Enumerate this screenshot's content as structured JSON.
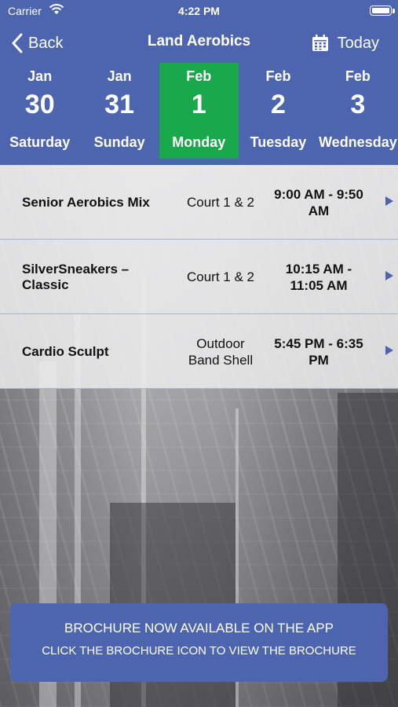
{
  "status_bar": {
    "carrier": "Carrier",
    "time": "4:22 PM"
  },
  "nav": {
    "back_label": "Back",
    "title": "Land Aerobics",
    "today_label": "Today"
  },
  "dates": [
    {
      "month": "Jan",
      "day": "30",
      "weekday": "Saturday",
      "selected": false
    },
    {
      "month": "Jan",
      "day": "31",
      "weekday": "Sunday",
      "selected": false
    },
    {
      "month": "Feb",
      "day": "1",
      "weekday": "Monday",
      "selected": true
    },
    {
      "month": "Feb",
      "day": "2",
      "weekday": "Tuesday",
      "selected": false
    },
    {
      "month": "Feb",
      "day": "3",
      "weekday": "Wednesday",
      "selected": false
    }
  ],
  "sessions": [
    {
      "name": "Senior Aerobics Mix",
      "location": "Court 1 & 2",
      "time": "9:00 AM - 9:50 AM"
    },
    {
      "name": "SilverSneakers – Classic",
      "location": "Court 1 & 2",
      "time": "10:15 AM - 11:05 AM"
    },
    {
      "name": "Cardio Sculpt",
      "location": "Outdoor Band Shell",
      "time": "5:45 PM - 6:35 PM"
    }
  ],
  "brochure": {
    "line1": "BROCHURE NOW AVAILABLE ON THE APP",
    "line2": "CLICK THE BROCHURE ICON TO VIEW THE BROCHURE"
  },
  "colors": {
    "primary": "#4d65af",
    "selected": "#1aa84d"
  }
}
